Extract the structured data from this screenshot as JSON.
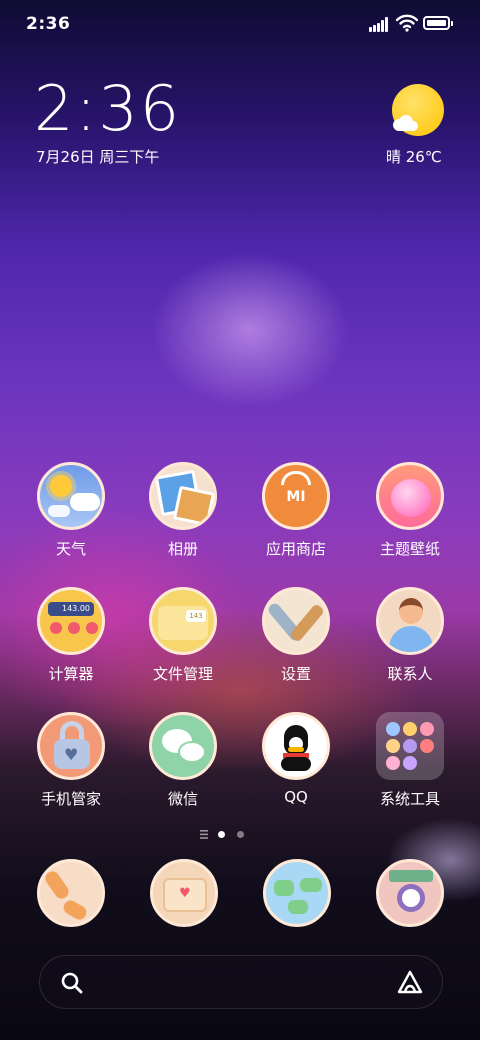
{
  "status_bar": {
    "time": "2:36"
  },
  "clock_widget": {
    "time": "2:36",
    "date": "7月26日 周三下午"
  },
  "weather_widget": {
    "text": "晴 26℃",
    "icon": "sunny-cloud-icon",
    "sun_color": "#FFC400"
  },
  "apps": [
    {
      "label": "天气",
      "icon": "weather-icon"
    },
    {
      "label": "相册",
      "icon": "gallery-icon"
    },
    {
      "label": "应用商店",
      "icon": "app-store-icon",
      "badge_text": "MI"
    },
    {
      "label": "主题壁纸",
      "icon": "themes-icon"
    },
    {
      "label": "计算器",
      "icon": "calculator-icon",
      "display_value": "143.00"
    },
    {
      "label": "文件管理",
      "icon": "file-manager-icon",
      "display_value": "143"
    },
    {
      "label": "设置",
      "icon": "settings-icon"
    },
    {
      "label": "联系人",
      "icon": "contacts-icon"
    },
    {
      "label": "手机管家",
      "icon": "security-icon"
    },
    {
      "label": "微信",
      "icon": "wechat-icon"
    },
    {
      "label": "QQ",
      "icon": "qq-icon"
    },
    {
      "label": "系统工具",
      "icon": "system-tools-folder-icon"
    }
  ],
  "page_indicator": {
    "pages": 2,
    "current": 1
  },
  "dock": [
    {
      "icon": "phone-icon"
    },
    {
      "icon": "messages-icon"
    },
    {
      "icon": "browser-icon"
    },
    {
      "icon": "camera-icon"
    }
  ],
  "search_bar": {
    "left_icon": "search-icon",
    "right_icon": "assistant-icon"
  }
}
